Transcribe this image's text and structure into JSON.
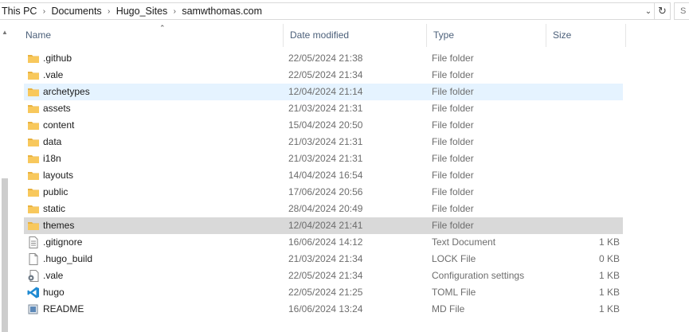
{
  "address": {
    "crumbs": [
      "This PC",
      "Documents",
      "Hugo_Sites",
      "samwthomas.com"
    ],
    "search_placeholder": "S"
  },
  "columns": {
    "name": "Name",
    "date": "Date modified",
    "type": "Type",
    "size": "Size"
  },
  "files": [
    {
      "name": ".github",
      "date": "22/05/2024 21:38",
      "type": "File folder",
      "size": "",
      "icon": "folder-icon"
    },
    {
      "name": ".vale",
      "date": "22/05/2024 21:34",
      "type": "File folder",
      "size": "",
      "icon": "folder-icon"
    },
    {
      "name": "archetypes",
      "date": "12/04/2024 21:14",
      "type": "File folder",
      "size": "",
      "icon": "folder-icon"
    },
    {
      "name": "assets",
      "date": "21/03/2024 21:31",
      "type": "File folder",
      "size": "",
      "icon": "folder-icon"
    },
    {
      "name": "content",
      "date": "15/04/2024 20:50",
      "type": "File folder",
      "size": "",
      "icon": "folder-icon"
    },
    {
      "name": "data",
      "date": "21/03/2024 21:31",
      "type": "File folder",
      "size": "",
      "icon": "folder-icon"
    },
    {
      "name": "i18n",
      "date": "21/03/2024 21:31",
      "type": "File folder",
      "size": "",
      "icon": "folder-icon"
    },
    {
      "name": "layouts",
      "date": "14/04/2024 16:54",
      "type": "File folder",
      "size": "",
      "icon": "folder-icon"
    },
    {
      "name": "public",
      "date": "17/06/2024 20:56",
      "type": "File folder",
      "size": "",
      "icon": "folder-icon"
    },
    {
      "name": "static",
      "date": "28/04/2024 20:49",
      "type": "File folder",
      "size": "",
      "icon": "folder-icon"
    },
    {
      "name": "themes",
      "date": "12/04/2024 21:41",
      "type": "File folder",
      "size": "",
      "icon": "folder-icon"
    },
    {
      "name": ".gitignore",
      "date": "16/06/2024 14:12",
      "type": "Text Document",
      "size": "1 KB",
      "icon": "text-document-icon"
    },
    {
      "name": ".hugo_build",
      "date": "21/03/2024 21:34",
      "type": "LOCK File",
      "size": "0 KB",
      "icon": "blank-file-icon"
    },
    {
      "name": ".vale",
      "date": "22/05/2024 21:34",
      "type": "Configuration settings",
      "size": "1 KB",
      "icon": "settings-file-icon"
    },
    {
      "name": "hugo",
      "date": "22/05/2024 21:25",
      "type": "TOML File",
      "size": "1 KB",
      "icon": "vscode-icon"
    },
    {
      "name": "README",
      "date": "16/06/2024 13:24",
      "type": "MD File",
      "size": "1 KB",
      "icon": "markdown-file-icon"
    }
  ],
  "state": {
    "hover_name": "archetypes",
    "selected_name": "themes"
  },
  "colors": {
    "hover": "#e5f3ff",
    "selected": "#d9d9d9",
    "folder": "#f8c85c",
    "header_text": "#4c607a"
  }
}
